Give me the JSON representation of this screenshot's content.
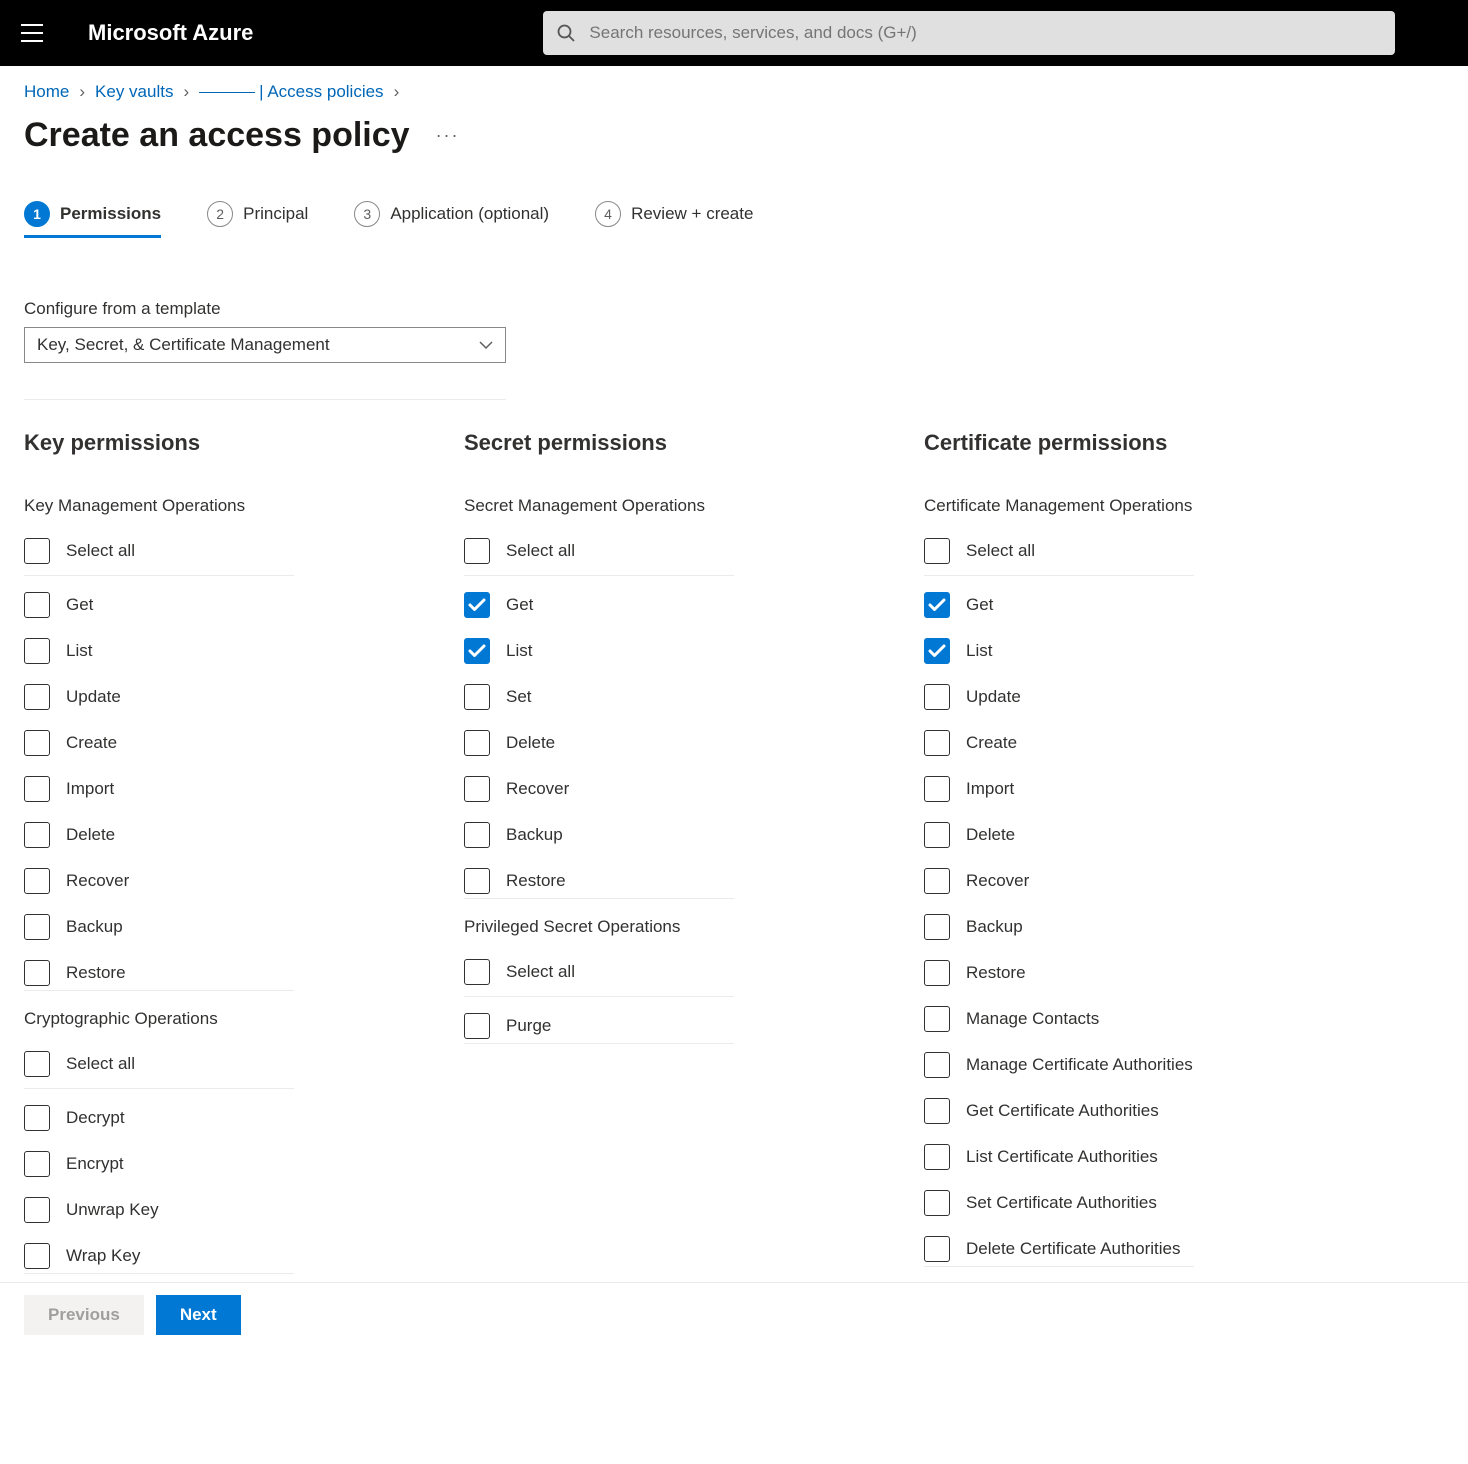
{
  "header": {
    "brand": "Microsoft Azure",
    "search_placeholder": "Search resources, services, and docs (G+/)"
  },
  "breadcrumb": {
    "items": [
      "Home",
      "Key vaults",
      "_____ | Access policies"
    ]
  },
  "page": {
    "title": "Create an access policy"
  },
  "tabs": [
    {
      "num": "1",
      "label": "Permissions",
      "active": true
    },
    {
      "num": "2",
      "label": "Principal",
      "active": false
    },
    {
      "num": "3",
      "label": "Application (optional)",
      "active": false
    },
    {
      "num": "4",
      "label": "Review + create",
      "active": false
    }
  ],
  "template_label": "Configure from a template",
  "template_value": "Key, Secret, & Certificate Management",
  "labels": {
    "select_all": "Select all"
  },
  "columns": {
    "key": {
      "title": "Key permissions",
      "groups": [
        {
          "title": "Key Management Operations",
          "items": [
            {
              "label": "Get",
              "checked": false
            },
            {
              "label": "List",
              "checked": false
            },
            {
              "label": "Update",
              "checked": false
            },
            {
              "label": "Create",
              "checked": false
            },
            {
              "label": "Import",
              "checked": false
            },
            {
              "label": "Delete",
              "checked": false
            },
            {
              "label": "Recover",
              "checked": false
            },
            {
              "label": "Backup",
              "checked": false
            },
            {
              "label": "Restore",
              "checked": false
            }
          ]
        },
        {
          "title": "Cryptographic Operations",
          "items": [
            {
              "label": "Decrypt",
              "checked": false
            },
            {
              "label": "Encrypt",
              "checked": false
            },
            {
              "label": "Unwrap Key",
              "checked": false
            },
            {
              "label": "Wrap Key",
              "checked": false
            }
          ]
        }
      ]
    },
    "secret": {
      "title": "Secret permissions",
      "groups": [
        {
          "title": "Secret Management Operations",
          "items": [
            {
              "label": "Get",
              "checked": true
            },
            {
              "label": "List",
              "checked": true
            },
            {
              "label": "Set",
              "checked": false
            },
            {
              "label": "Delete",
              "checked": false
            },
            {
              "label": "Recover",
              "checked": false
            },
            {
              "label": "Backup",
              "checked": false
            },
            {
              "label": "Restore",
              "checked": false
            }
          ]
        },
        {
          "title": "Privileged Secret Operations",
          "items": [
            {
              "label": "Purge",
              "checked": false
            }
          ]
        }
      ]
    },
    "cert": {
      "title": "Certificate permissions",
      "groups": [
        {
          "title": "Certificate Management Operations",
          "items": [
            {
              "label": "Get",
              "checked": true
            },
            {
              "label": "List",
              "checked": true
            },
            {
              "label": "Update",
              "checked": false
            },
            {
              "label": "Create",
              "checked": false
            },
            {
              "label": "Import",
              "checked": false
            },
            {
              "label": "Delete",
              "checked": false
            },
            {
              "label": "Recover",
              "checked": false
            },
            {
              "label": "Backup",
              "checked": false
            },
            {
              "label": "Restore",
              "checked": false
            },
            {
              "label": "Manage Contacts",
              "checked": false
            },
            {
              "label": "Manage Certificate Authorities",
              "checked": false
            },
            {
              "label": "Get Certificate Authorities",
              "checked": false
            },
            {
              "label": "List Certificate Authorities",
              "checked": false
            },
            {
              "label": "Set Certificate Authorities",
              "checked": false
            },
            {
              "label": "Delete Certificate Authorities",
              "checked": false
            }
          ]
        }
      ]
    }
  },
  "footer": {
    "previous": "Previous",
    "next": "Next"
  }
}
